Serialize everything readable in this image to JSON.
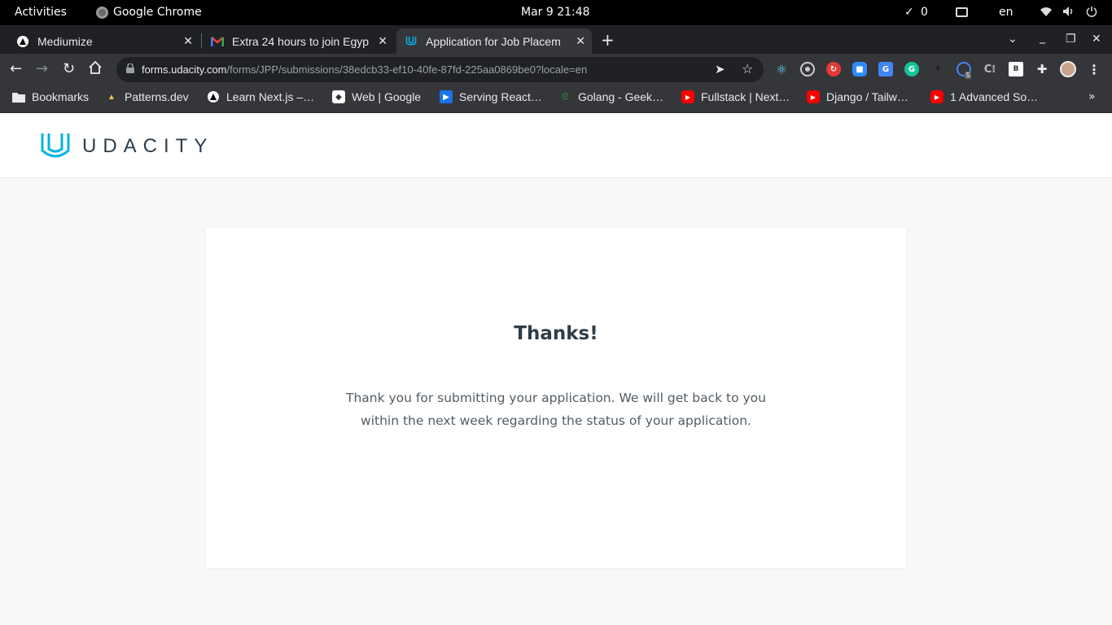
{
  "topbar": {
    "activities": "Activities",
    "app_name": "Google Chrome",
    "clock": "Mar 9  21:48",
    "notifications_count": "0",
    "language": "en"
  },
  "tabs": [
    {
      "title": "Mediumize",
      "icon": "mediumize-icon"
    },
    {
      "title": "Extra 24 hours to join Egyp",
      "icon": "gmail-icon"
    },
    {
      "title": "Application for Job Placem",
      "icon": "udacity-icon",
      "active": true
    }
  ],
  "address_bar": {
    "host": "forms.udacity.com",
    "path": "/forms/JPP/submissions/38edcb33-ef10-40fe-87fd-225aa0869be0?locale=en"
  },
  "extension_badge": "5",
  "bookmarks": [
    {
      "label": "Bookmarks",
      "icon": "folder-icon"
    },
    {
      "label": "Patterns.dev",
      "icon": "patterns-icon"
    },
    {
      "label": "Learn Next.js –…",
      "icon": "nextjs-icon"
    },
    {
      "label": "Web | Google",
      "icon": "google-web-icon"
    },
    {
      "label": "Serving React…",
      "icon": "video-icon"
    },
    {
      "label": "Golang - Geek…",
      "icon": "geeksforgeeks-icon"
    },
    {
      "label": "Fullstack | Next…",
      "icon": "youtube-icon"
    },
    {
      "label": "Django / Tailw…",
      "icon": "youtube-icon"
    },
    {
      "label": "1 Advanced So…",
      "icon": "youtube-icon"
    }
  ],
  "page": {
    "logo_text": "UDACITY",
    "heading": "Thanks!",
    "message": "Thank you for submitting your application. We will get back to you within the next week regarding the status of your application."
  },
  "colors": {
    "brand": "#02b3e4",
    "heading": "#2e3d49",
    "body_text": "#525c65",
    "page_bg": "#f7f8fa"
  }
}
